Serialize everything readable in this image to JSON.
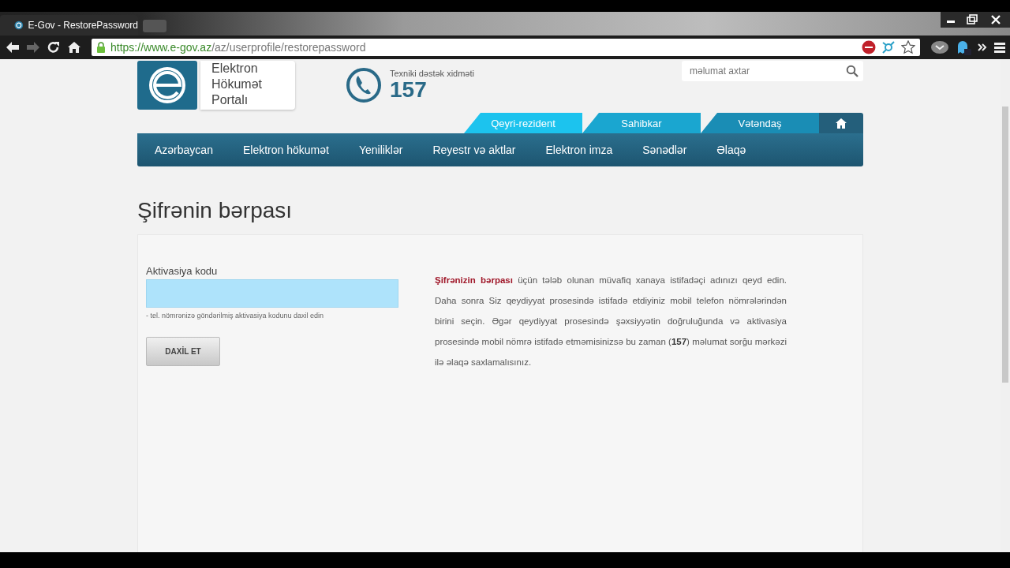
{
  "browser": {
    "tab_title": "E-Gov - RestorePassword",
    "url_host": "https://www.e-gov.az",
    "url_path": "/az/userprofile/restorepassword"
  },
  "header": {
    "logo_lines": [
      "Elektron",
      "Hökumət",
      "Portalı"
    ],
    "support_label": "Texniki dəstək xidməti",
    "support_number": "157",
    "search": {
      "placeholder": "məlumat axtar"
    }
  },
  "audience_tabs": [
    {
      "label": "Qeyri-rezident",
      "color": "#1cc3ee"
    },
    {
      "label": "Sahibkar",
      "color": "#1aa6d0"
    },
    {
      "label": "Vətəndaş",
      "color": "#1a8db5"
    }
  ],
  "nav": [
    "Azərbaycan",
    "Elektron hökumət",
    "Yeniliklər",
    "Reyestr və aktlar",
    "Elektron imza",
    "Sənədlər",
    "Əlaqə"
  ],
  "page_title": "Şifrənin bərpası",
  "form": {
    "label": "Aktivasiya kodu",
    "focused": true,
    "hint": "- tel. nömrənizə göndərilmiş aktivasiya kodunu daxil edin",
    "button": "DAXİL ET"
  },
  "info": "**Şifrənizin bərpası** üçün tələb olunan müvafiq xanaya istifadəçi adınızı qeyd edin. Daha sonra Siz qeydiyyat prosesində istifadə etdiyiniz mobil telefon nömrələrindən birini seçin. Əgər qeydiyyat prosesində şəxsiyyətin doğruluğunda və aktivasiya prosesində mobil nömrə istifadə etməmisinizsə bu zaman (**157**) məlumat sorğu mərkəzi ilə əlaqə saxlamalısınız."
}
